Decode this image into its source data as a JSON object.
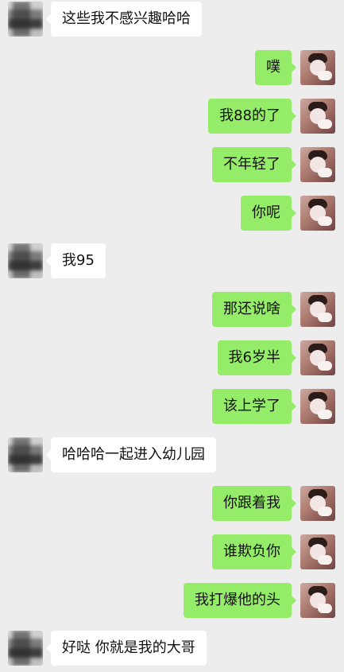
{
  "theme": {
    "background": "#ededed",
    "incoming_bubble": "#ffffff",
    "outgoing_bubble": "#95ec69"
  },
  "messages": [
    {
      "side": "left",
      "text": "这些我不感兴趣哈哈"
    },
    {
      "side": "right",
      "text": "噗"
    },
    {
      "side": "right",
      "text": "我88的了"
    },
    {
      "side": "right",
      "text": "不年轻了"
    },
    {
      "side": "right",
      "text": "你呢"
    },
    {
      "side": "left",
      "text": "我95"
    },
    {
      "side": "right",
      "text": "那还说啥"
    },
    {
      "side": "right",
      "text": "我6岁半"
    },
    {
      "side": "right",
      "text": "该上学了"
    },
    {
      "side": "left",
      "text": "哈哈哈一起进入幼儿园"
    },
    {
      "side": "right",
      "text": "你跟着我"
    },
    {
      "side": "right",
      "text": "谁欺负你"
    },
    {
      "side": "right",
      "text": "我打爆他的头"
    },
    {
      "side": "left",
      "text": "好哒 你就是我的大哥"
    }
  ]
}
